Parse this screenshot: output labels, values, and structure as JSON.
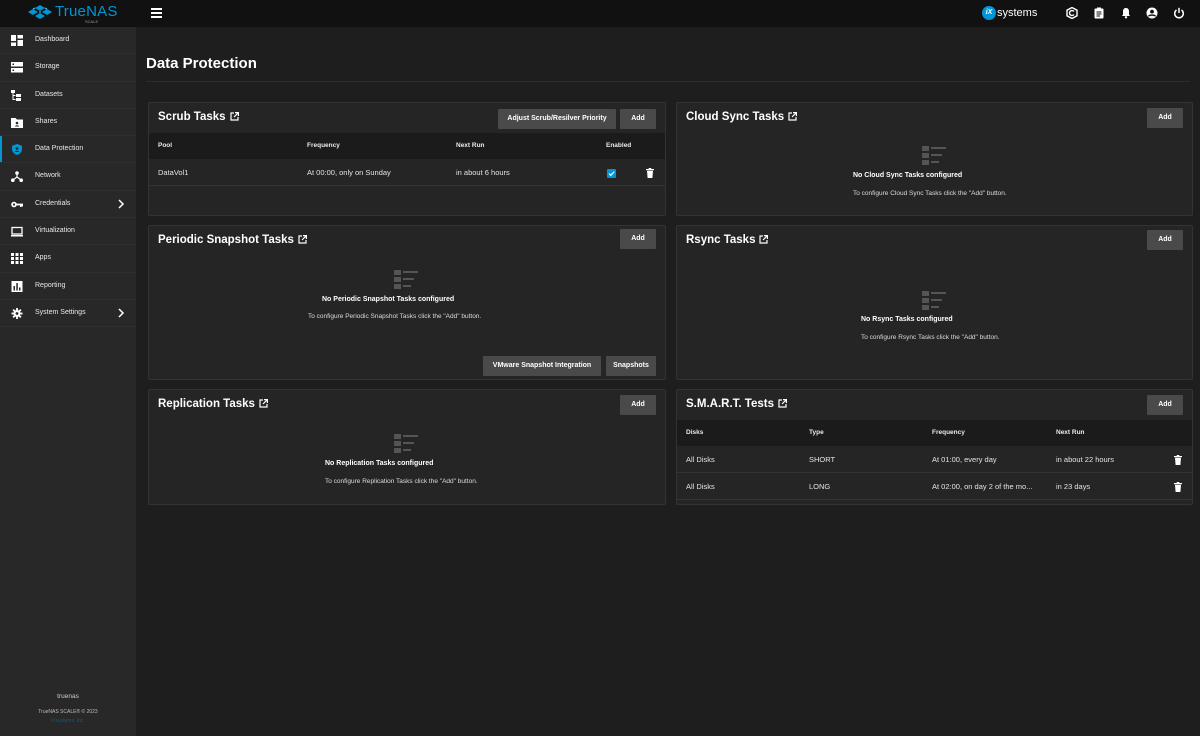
{
  "header": {
    "brand": "TrueNAS",
    "brand_sub": "SCALE",
    "vendor_mark": "iX",
    "vendor": "systems",
    "icons": [
      "truecommand-icon",
      "clipboard-icon",
      "bell-icon",
      "account-icon",
      "power-icon"
    ]
  },
  "sidebar": {
    "items": [
      {
        "label": "Dashboard",
        "icon": "dashboard-icon"
      },
      {
        "label": "Storage",
        "icon": "storage-icon"
      },
      {
        "label": "Datasets",
        "icon": "datasets-icon"
      },
      {
        "label": "Shares",
        "icon": "shares-icon"
      },
      {
        "label": "Data Protection",
        "icon": "shield-icon",
        "active": true
      },
      {
        "label": "Network",
        "icon": "network-icon"
      },
      {
        "label": "Credentials",
        "icon": "key-icon",
        "has_children": true
      },
      {
        "label": "Virtualization",
        "icon": "laptop-icon"
      },
      {
        "label": "Apps",
        "icon": "apps-icon"
      },
      {
        "label": "Reporting",
        "icon": "reporting-icon"
      },
      {
        "label": "System Settings",
        "icon": "gear-icon",
        "has_children": true
      }
    ],
    "hostname": "truenas",
    "copyright": "TrueNAS SCALE® © 2023",
    "company": "iXsystems, Inc."
  },
  "page": {
    "title": "Data Protection"
  },
  "scrub": {
    "title": "Scrub Tasks",
    "adjust_label": "Adjust Scrub/Resilver Priority",
    "add_label": "Add",
    "columns": [
      "Pool",
      "Frequency",
      "Next Run",
      "Enabled"
    ],
    "rows": [
      {
        "pool": "DataVol1",
        "frequency": "At 00:00, only on Sunday",
        "next_run": "in about 6 hours",
        "enabled": true
      }
    ]
  },
  "cloud_sync": {
    "title": "Cloud Sync Tasks",
    "add_label": "Add",
    "empty_title": "No Cloud Sync Tasks configured",
    "empty_desc": "To configure Cloud Sync Tasks click the \"Add\" button."
  },
  "periodic_snapshot": {
    "title": "Periodic Snapshot Tasks",
    "add_label": "Add",
    "empty_title": "No Periodic Snapshot Tasks configured",
    "empty_desc": "To configure Periodic Snapshot Tasks click the \"Add\" button.",
    "vmware_label": "VMware Snapshot Integration",
    "snapshots_label": "Snapshots"
  },
  "rsync": {
    "title": "Rsync Tasks",
    "add_label": "Add",
    "empty_title": "No Rsync Tasks configured",
    "empty_desc": "To configure Rsync Tasks click the \"Add\" button."
  },
  "replication": {
    "title": "Replication Tasks",
    "add_label": "Add",
    "empty_title": "No Replication Tasks configured",
    "empty_desc": "To configure Replication Tasks click the \"Add\" button."
  },
  "smart": {
    "title": "S.M.A.R.T. Tests",
    "add_label": "Add",
    "columns": [
      "Disks",
      "Type",
      "Frequency",
      "Next Run"
    ],
    "rows": [
      {
        "disks": "All Disks",
        "type": "SHORT",
        "frequency": "At 01:00, every day",
        "next_run": "in about 22 hours"
      },
      {
        "disks": "All Disks",
        "type": "LONG",
        "frequency": "At 02:00, on day 2 of the mo...",
        "next_run": "in 23 days"
      }
    ]
  },
  "colors": {
    "accent": "#0095d5",
    "background": "#1e1e1e",
    "card": "#252525",
    "button": "#4a4a4a"
  }
}
